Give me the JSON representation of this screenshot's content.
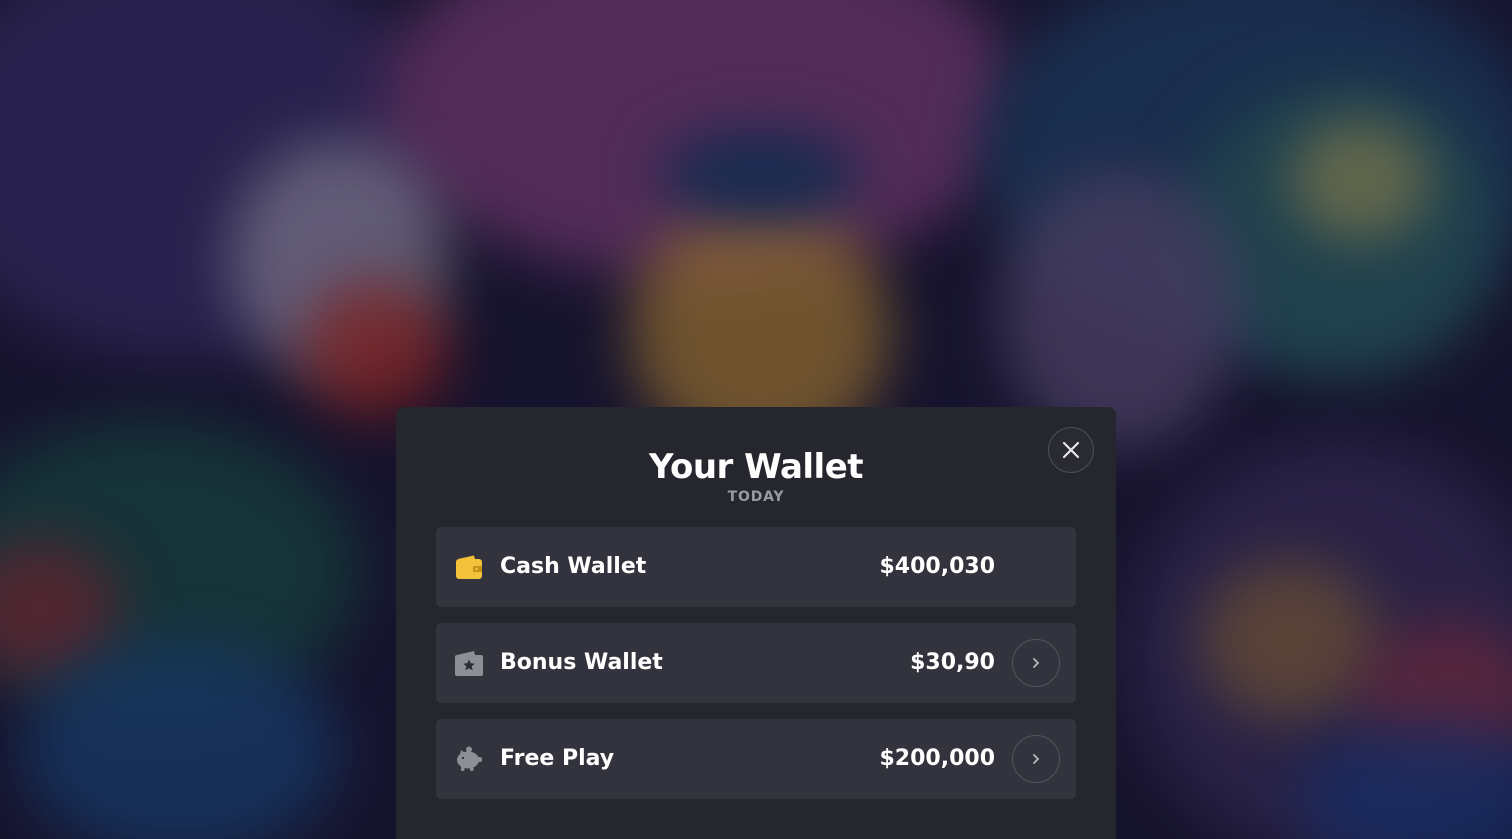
{
  "modal": {
    "title": "Your Wallet",
    "subtitle": "TODAY",
    "close_icon": "close-icon"
  },
  "wallets": [
    {
      "label": "Cash Wallet",
      "amount": "$400,030",
      "icon": "wallet-icon",
      "icon_color": "#f4c13a",
      "has_details": false
    },
    {
      "label": "Bonus Wallet",
      "amount": "$30,90",
      "icon": "bonus-wallet-star-icon",
      "icon_color": "#8e8e96",
      "has_details": true
    },
    {
      "label": "Free Play",
      "amount": "$200,000",
      "icon": "piggy-bank-icon",
      "icon_color": "#8e8e96",
      "has_details": true
    }
  ],
  "colors": {
    "modal_bg": "#26262e",
    "row_bg": "#33333d",
    "accent": "#f4c13a",
    "muted_text": "#9a9aa3"
  }
}
